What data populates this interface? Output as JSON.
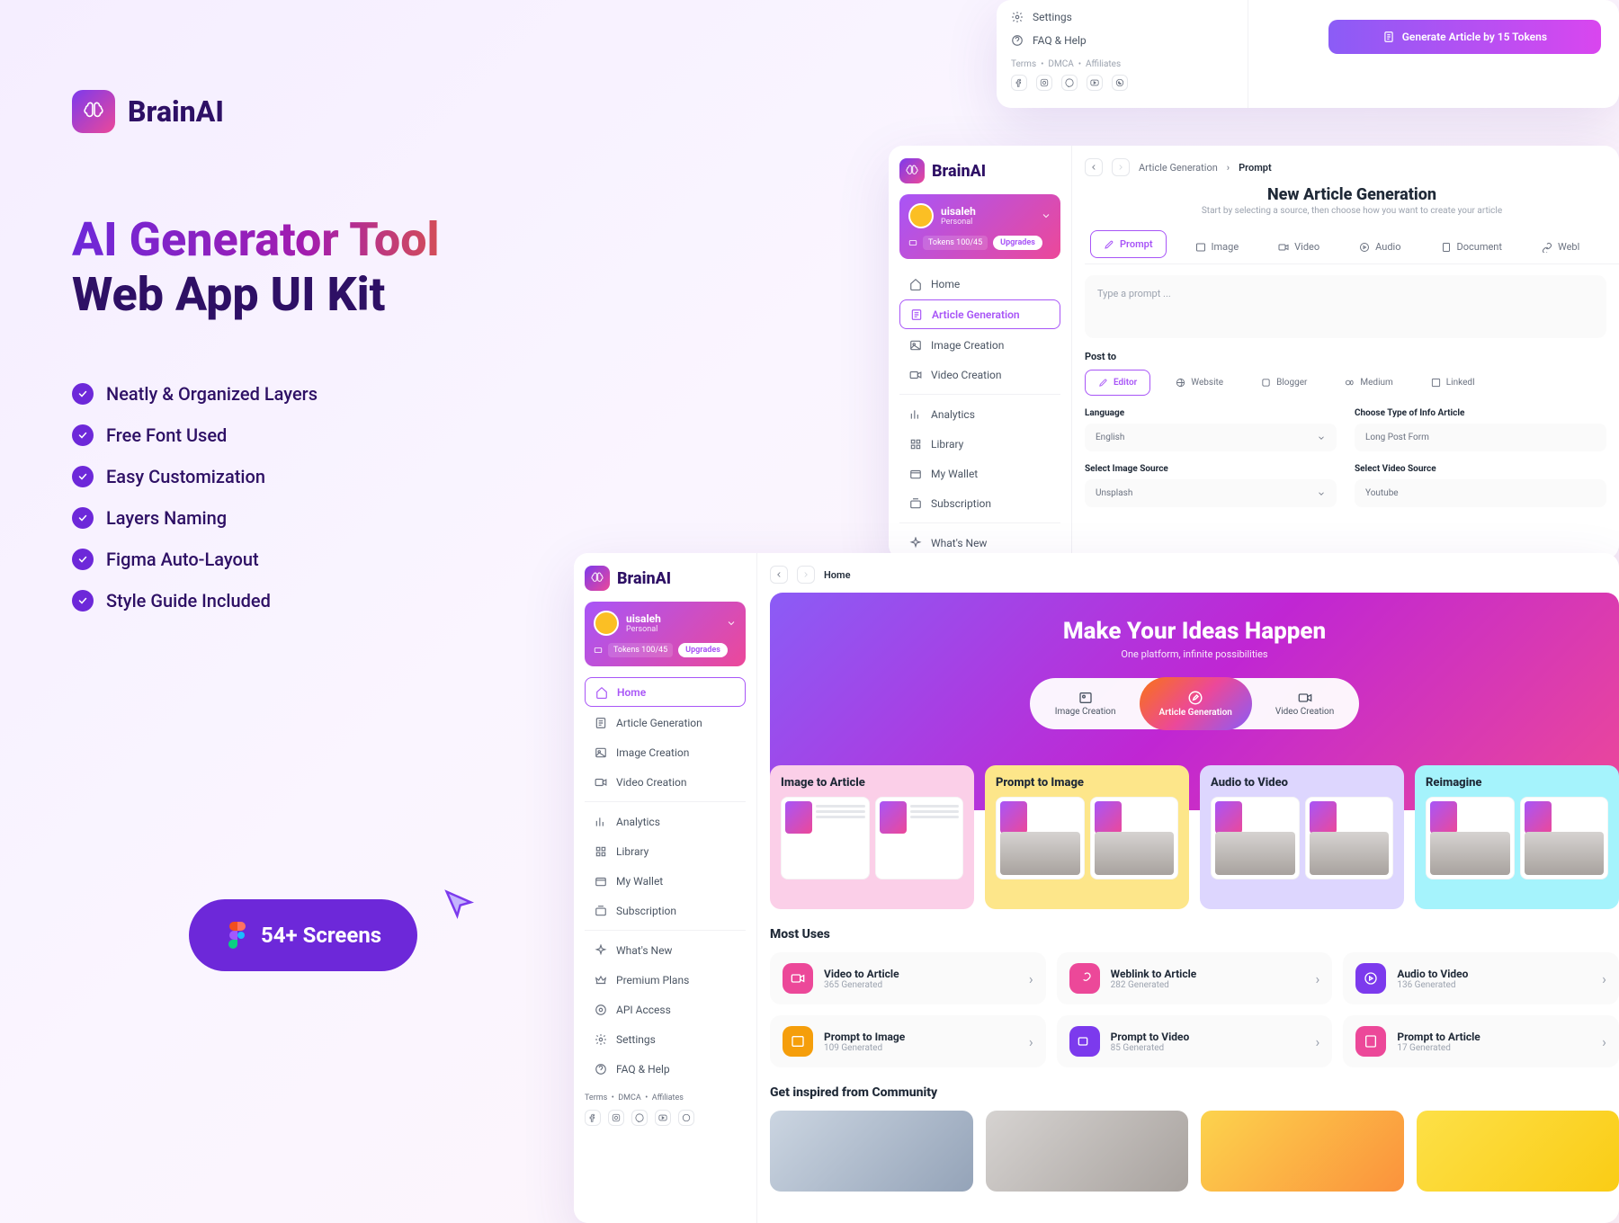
{
  "brand": {
    "name": "BrainAI"
  },
  "promo": {
    "headline1": "AI Generator Tool",
    "headline2": "Web App UI Kit",
    "features": [
      "Neatly & Organized Layers",
      "Free Font Used",
      "Easy Customization",
      "Layers Naming",
      "Figma Auto-Layout",
      "Style Guide Included"
    ],
    "screens_badge": "54+ Screens"
  },
  "panel1": {
    "nav": {
      "settings": "Settings",
      "faq": "FAQ & Help"
    },
    "footer": {
      "terms": "Terms",
      "dmca": "DMCA",
      "affiliates": "Affiliates"
    },
    "cta": "Generate Article by 15 Tokens"
  },
  "user": {
    "name": "uisaleh",
    "plan": "Personal",
    "tokens": "Tokens 100/45",
    "upgrade": "Upgrades"
  },
  "nav": {
    "home": "Home",
    "article": "Article Generation",
    "image": "Image Creation",
    "video": "Video Creation",
    "analytics": "Analytics",
    "library": "Library",
    "wallet": "My Wallet",
    "subscription": "Subscription",
    "whatsnew": "What's New",
    "premium": "Premium Plans",
    "api": "API Access",
    "settings": "Settings",
    "faq": "FAQ & Help"
  },
  "footer": {
    "terms": "Terms",
    "dmca": "DMCA",
    "affiliates": "Affiliates"
  },
  "panel2": {
    "breadcrumb": {
      "parent": "Article Generation",
      "current": "Prompt"
    },
    "title": "New Article Generation",
    "subtitle": "Start by selecting a source, then choose how you want to create your article",
    "tabs": [
      "Prompt",
      "Image",
      "Video",
      "Audio",
      "Document",
      "Webl"
    ],
    "prompt_placeholder": "Type a prompt ...",
    "post_label": "Post to",
    "post_options": [
      "Editor",
      "Website",
      "Blogger",
      "Medium",
      "LinkedI"
    ],
    "fields": {
      "language": {
        "label": "Language",
        "value": "English"
      },
      "type": {
        "label": "Choose Type of Info Article",
        "value": "Long Post Form"
      },
      "img_src": {
        "label": "Select Image Source",
        "value": "Unsplash"
      },
      "vid_src": {
        "label": "Select Video Source",
        "value": "Youtube"
      }
    }
  },
  "panel3": {
    "breadcrumb": "Home",
    "hero": {
      "title": "Make Your Ideas Happen",
      "subtitle": "One platform, infinite possibilities",
      "tabs": [
        "Image Creation",
        "Article Generation",
        "Video Creation"
      ]
    },
    "tools": [
      "Image to Article",
      "Prompt to Image",
      "Audio to Video",
      "Reimagine"
    ],
    "most_uses_title": "Most Uses",
    "most_uses": [
      {
        "title": "Video to Article",
        "sub": "365 Generated"
      },
      {
        "title": "Weblink to Article",
        "sub": "282 Generated"
      },
      {
        "title": "Audio to Video",
        "sub": "136 Generated"
      },
      {
        "title": "Prompt to Image",
        "sub": "109 Generated"
      },
      {
        "title": "Prompt to Video",
        "sub": "85 Generated"
      },
      {
        "title": "Prompt to Article",
        "sub": "17 Generated"
      }
    ],
    "community_title": "Get inspired from Community"
  }
}
